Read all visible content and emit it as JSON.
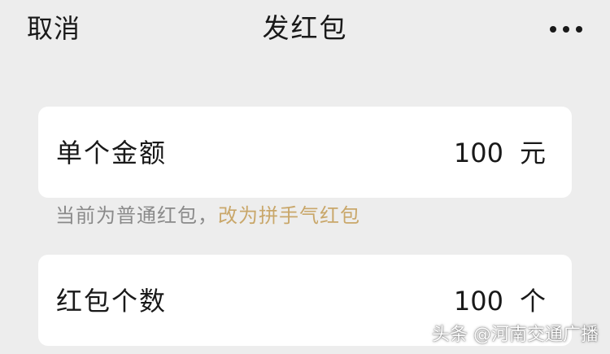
{
  "nav": {
    "cancel_label": "取消",
    "title": "发红包",
    "more_icon": "more-dots-icon"
  },
  "amount_card": {
    "label": "单个金额",
    "value": "100",
    "unit": "元"
  },
  "hint": {
    "static_text": "当前为普通红包，",
    "link_text": "改为拼手气红包"
  },
  "count_card": {
    "label": "红包个数",
    "value": "100",
    "unit": "个"
  },
  "watermark": {
    "text": "头条 @河南交通广播"
  },
  "colors": {
    "background": "#ededed",
    "card": "#ffffff",
    "link": "#c9a76a",
    "hint": "#8a8a8a",
    "text": "#191919"
  }
}
